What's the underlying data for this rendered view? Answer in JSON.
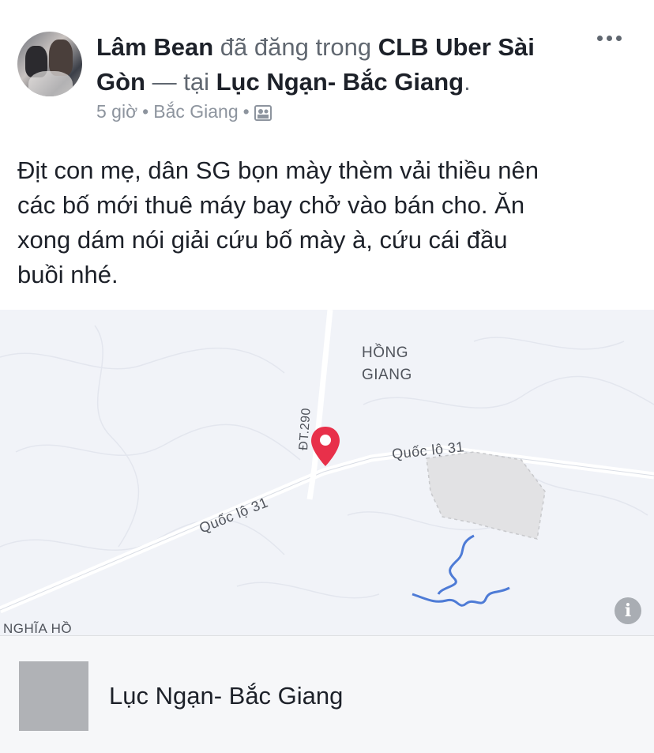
{
  "post": {
    "author": "Lâm Bean",
    "action_text": "đã đăng trong",
    "group": "CLB Uber Sài Gòn",
    "location_sep": "— tại",
    "location": "Lục Ngạn- Bắc Giang",
    "title_end": ".",
    "time": "5 giờ",
    "meta_location": "Bắc Giang",
    "privacy_icon": "group-icon",
    "more_icon": "more-options-icon",
    "body": "Địt con mẹ, dân SG bọn mày thèm vải thiều nên\ncác bố mới thuê máy bay chở vào bán cho. Ăn\nxong dám nói giải cứu bố mày à, cứu cái đầu\nbuồi nhé."
  },
  "map": {
    "labels": {
      "hong_giang_1": "HỒNG",
      "hong_giang_2": "GIANG",
      "dt290": "ĐT.290",
      "road_right": "Quốc lộ 31",
      "road_left": "Quốc lộ 31",
      "nghia_ho": "NGHĨA HỒ"
    },
    "pin_color": "#e8304a",
    "info_icon": "i"
  },
  "place": {
    "name": "Lục Ngạn- Bắc Giang"
  }
}
